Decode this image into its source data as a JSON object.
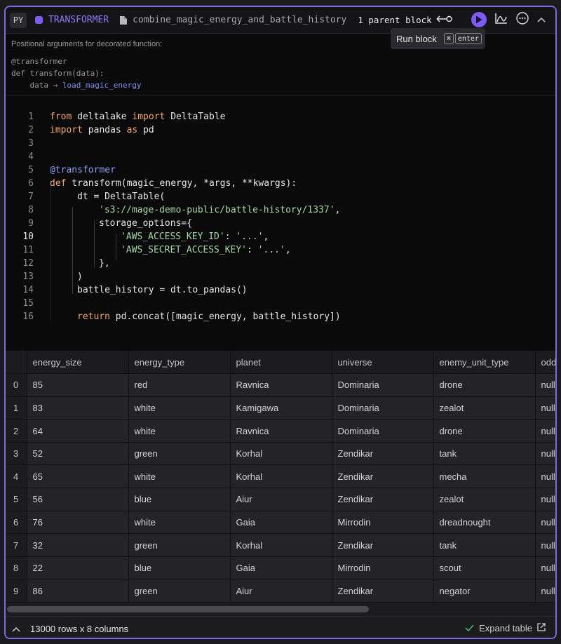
{
  "header": {
    "language": "PY",
    "block_type": "TRANSFORMER",
    "block_name": "combine_magic_energy_and_battle_history",
    "parents": "1 parent block",
    "tooltip": {
      "label": "Run block",
      "key1": "⌘",
      "key2": "enter"
    },
    "accent_color": "#7d5cf5"
  },
  "args": {
    "title": "Positional arguments for decorated function:",
    "decorator": "@transformer",
    "signature": "def transform(data):",
    "arg_name": "data",
    "arrow": "→",
    "arg_source": "load_magic_energy"
  },
  "code": {
    "line_numbers": [
      "1",
      "2",
      "3",
      "4",
      "5",
      "6",
      "7",
      "8",
      "9",
      "10",
      "11",
      "12",
      "13",
      "14",
      "15",
      "16"
    ],
    "active_line": "10",
    "l1_kw1": "from",
    "l1_mod": " deltalake ",
    "l1_kw2": "import",
    "l1_name": " DeltaTable",
    "l2_kw1": "import",
    "l2_mod": " pandas ",
    "l2_kw2": "as",
    "l2_name": " pd",
    "l5": "@transformer",
    "l6_kw": "def",
    "l6_rest": " transform(magic_energy, *args, **kwargs):",
    "l7": "dt = DeltaTable(",
    "l8": "'s3://mage-demo-public/battle-history/1337'",
    "l8_comma": ",",
    "l9": "storage_options={",
    "l10_str1": "'AWS_ACCESS_KEY_ID'",
    "l10_colon": ": ",
    "l10_str2": "'...'",
    "l10_comma": ",",
    "l11_str1": "'AWS_SECRET_ACCESS_KEY'",
    "l11_colon": ": ",
    "l11_str2": "'...'",
    "l11_comma": ",",
    "l12": "},",
    "l13": ")",
    "l14": "battle_history = dt.to_pandas()",
    "l16_kw": "return",
    "l16_rest": " pd.concat([magic_energy, battle_history])"
  },
  "table": {
    "columns": [
      "",
      "energy_size",
      "energy_type",
      "planet",
      "universe",
      "enemy_unit_type",
      "odd"
    ],
    "rows": [
      [
        "0",
        "85",
        "red",
        "Ravnica",
        "Dominaria",
        "drone",
        "null"
      ],
      [
        "1",
        "83",
        "white",
        "Kamigawa",
        "Dominaria",
        "zealot",
        "null"
      ],
      [
        "2",
        "64",
        "white",
        "Ravnica",
        "Dominaria",
        "drone",
        "null"
      ],
      [
        "3",
        "52",
        "green",
        "Korhal",
        "Zendikar",
        "tank",
        "null"
      ],
      [
        "4",
        "65",
        "white",
        "Korhal",
        "Zendikar",
        "mecha",
        "null"
      ],
      [
        "5",
        "56",
        "blue",
        "Aiur",
        "Zendikar",
        "zealot",
        "null"
      ],
      [
        "6",
        "76",
        "white",
        "Gaia",
        "Mirrodin",
        "dreadnought",
        "null"
      ],
      [
        "7",
        "32",
        "green",
        "Korhal",
        "Zendikar",
        "tank",
        "null"
      ],
      [
        "8",
        "22",
        "blue",
        "Gaia",
        "Mirrodin",
        "scout",
        "null"
      ],
      [
        "9",
        "86",
        "green",
        "Aiur",
        "Zendikar",
        "negator",
        "null"
      ]
    ]
  },
  "footer": {
    "summary": "13000 rows x 8 columns",
    "expand_label": "Expand table"
  }
}
